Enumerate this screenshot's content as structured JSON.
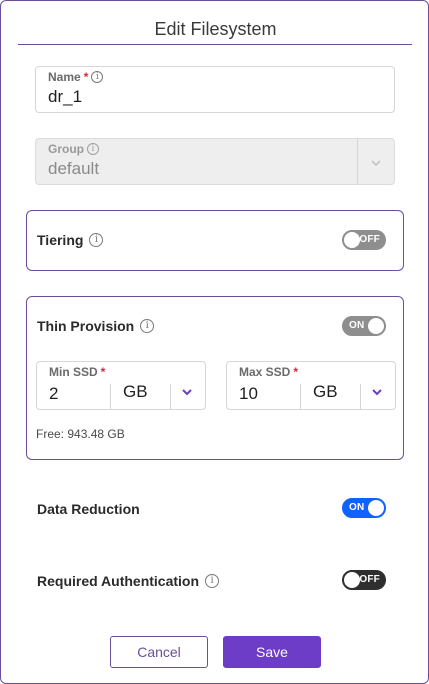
{
  "dialog": {
    "title": "Edit Filesystem"
  },
  "name_field": {
    "label": "Name",
    "required_mark": "*",
    "value": "dr_1"
  },
  "group_field": {
    "label": "Group",
    "value": "default",
    "disabled": true
  },
  "tiering": {
    "label": "Tiering",
    "toggle_text": "OFF",
    "state": "off"
  },
  "thin_provision": {
    "label": "Thin Provision",
    "toggle_text": "ON",
    "state": "on",
    "min_ssd": {
      "label": "Min SSD",
      "required_mark": "*",
      "value": "2",
      "unit": "GB"
    },
    "max_ssd": {
      "label": "Max SSD",
      "required_mark": "*",
      "value": "10",
      "unit": "GB"
    },
    "free_text": "Free: 943.48 GB"
  },
  "data_reduction": {
    "label": "Data Reduction",
    "toggle_text": "ON",
    "state": "on"
  },
  "required_auth": {
    "label": "Required Authentication",
    "toggle_text": "OFF",
    "state": "off"
  },
  "actions": {
    "cancel_label": "Cancel",
    "save_label": "Save"
  },
  "icons": {
    "info": "info-icon",
    "dropdown": "chevron-down-icon"
  },
  "colors": {
    "accent": "#6d3dc8",
    "border_accent": "#6b4f9a",
    "toggle_on": "#0f62fe",
    "required": "#d6263d"
  }
}
